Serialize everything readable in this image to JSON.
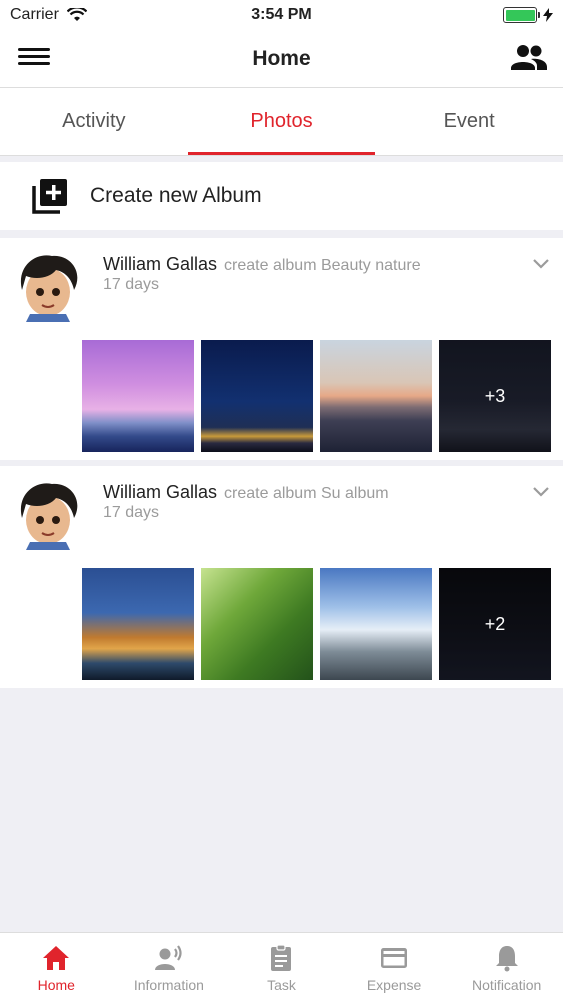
{
  "status_bar": {
    "carrier": "Carrier",
    "time": "3:54 PM"
  },
  "navbar": {
    "title": "Home"
  },
  "tabs": [
    {
      "label": "Activity",
      "active": false
    },
    {
      "label": "Photos",
      "active": true
    },
    {
      "label": "Event",
      "active": false
    }
  ],
  "create_album": {
    "label": "Create new Album"
  },
  "posts": [
    {
      "user": "William Gallas",
      "action": "create album Beauty nature",
      "time": "17 days",
      "more_count": "+3"
    },
    {
      "user": "William Gallas",
      "action": "create album Su album",
      "time": "17 days",
      "more_count": "+2"
    }
  ],
  "tabbar": [
    {
      "label": "Home",
      "icon": "home-icon",
      "active": true
    },
    {
      "label": "Information",
      "icon": "speaker-person-icon",
      "active": false
    },
    {
      "label": "Task",
      "icon": "clipboard-icon",
      "active": false
    },
    {
      "label": "Expense",
      "icon": "credit-card-icon",
      "active": false
    },
    {
      "label": "Notification",
      "icon": "bell-icon",
      "active": false
    }
  ],
  "colors": {
    "accent": "#e0242c",
    "inactive": "#9a9a9a",
    "battery": "#34c759"
  }
}
